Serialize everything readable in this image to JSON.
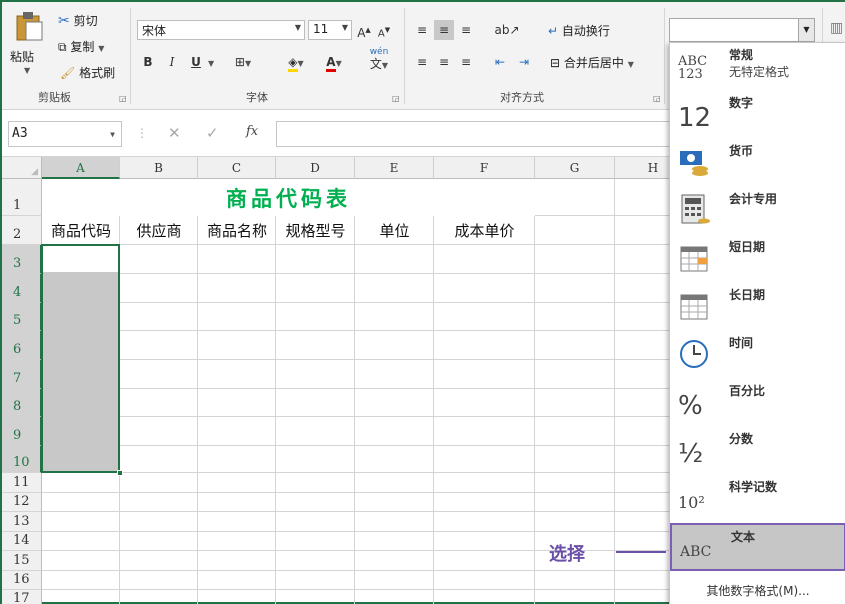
{
  "clipboard": {
    "paste_label": "粘贴",
    "cut_label": "剪切",
    "copy_label": "复制",
    "format_painter_label": "格式刷",
    "group_label": "剪贴板"
  },
  "font": {
    "name_value": "宋体",
    "size_value": "11",
    "group_label": "字体",
    "bold": "B",
    "italic": "I",
    "underline": "U",
    "grow": "A",
    "shrink": "A",
    "font_color": "A",
    "phonetic_top": "wén",
    "phonetic_bottom": "文"
  },
  "alignment": {
    "wrap_label": "自动换行",
    "merge_label": "合并后居中",
    "group_label": "对齐方式"
  },
  "formula_bar": {
    "name_box": "A3",
    "fx": "fx"
  },
  "columns": [
    "A",
    "B",
    "C",
    "D",
    "E",
    "F",
    "G",
    "H"
  ],
  "rows": [
    "1",
    "2",
    "3",
    "4",
    "5",
    "6",
    "7",
    "8",
    "9",
    "10",
    "11",
    "12",
    "13",
    "14",
    "15",
    "16",
    "17"
  ],
  "sheet": {
    "title": "商品代码表",
    "headers": [
      "商品代码",
      "供应商",
      "商品名称",
      "规格型号",
      "单位",
      "成本单价"
    ]
  },
  "number_format_menu": {
    "items": [
      {
        "icon": "abc-123-icon",
        "icon_text": "ABC\n123",
        "label": "常规",
        "sub": "无特定格式"
      },
      {
        "icon": "number-12-icon",
        "icon_text": "12",
        "label": "数字",
        "sub": ""
      },
      {
        "icon": "currency-icon",
        "icon_text": "",
        "label": "货币",
        "sub": ""
      },
      {
        "icon": "accounting-icon",
        "icon_text": "",
        "label": "会计专用",
        "sub": ""
      },
      {
        "icon": "short-date-calendar-icon",
        "icon_text": "",
        "label": "短日期",
        "sub": ""
      },
      {
        "icon": "long-date-calendar-icon",
        "icon_text": "",
        "label": "长日期",
        "sub": ""
      },
      {
        "icon": "clock-icon",
        "icon_text": "",
        "label": "时间",
        "sub": ""
      },
      {
        "icon": "percent-icon",
        "icon_text": "%",
        "label": "百分比",
        "sub": ""
      },
      {
        "icon": "fraction-icon",
        "icon_text": "½",
        "label": "分数",
        "sub": ""
      },
      {
        "icon": "scientific-icon",
        "icon_text": "10²",
        "label": "科学记数",
        "sub": ""
      },
      {
        "icon": "text-abc-icon",
        "icon_text": "ABC",
        "label": "文本",
        "sub": ""
      }
    ],
    "selected_index": 10,
    "more_label": "其他数字格式(M)..."
  },
  "annotation": {
    "text": "选择"
  }
}
